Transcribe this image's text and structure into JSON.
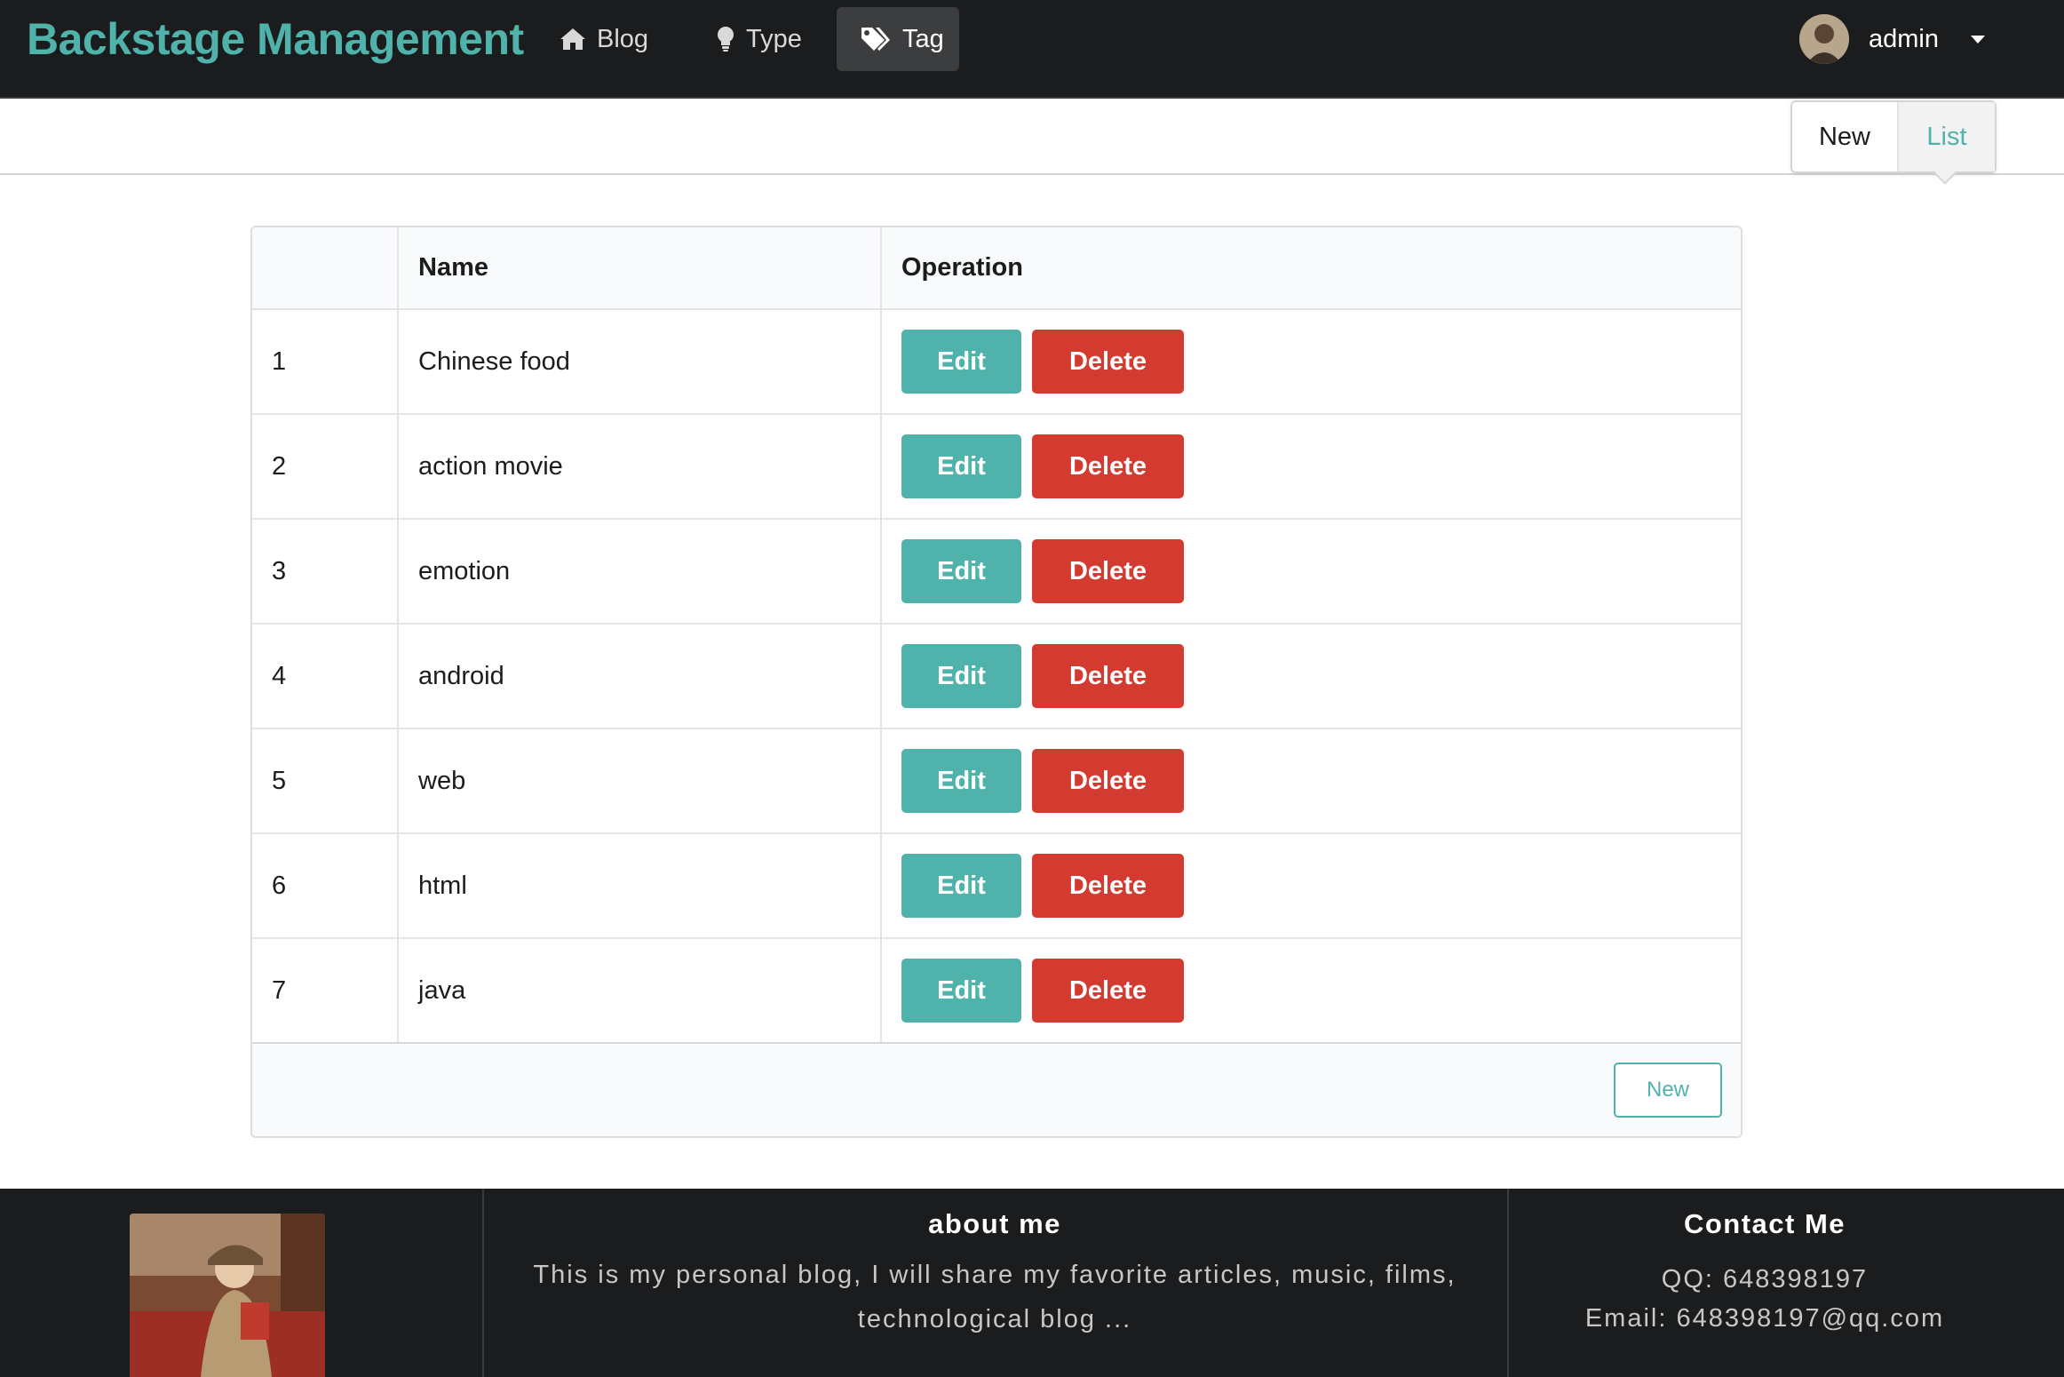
{
  "header": {
    "brand": "Backstage Management",
    "nav": [
      {
        "label": "Blog",
        "icon": "home-icon"
      },
      {
        "label": "Type",
        "icon": "lightbulb-icon"
      },
      {
        "label": "Tag",
        "icon": "tags-icon",
        "active": true
      }
    ],
    "user": {
      "name": "admin"
    }
  },
  "submenu": {
    "tabs": [
      {
        "label": "New"
      },
      {
        "label": "List",
        "active": true
      }
    ]
  },
  "table": {
    "columns": [
      "",
      "Name",
      "Operation"
    ],
    "rows": [
      {
        "id": "1",
        "name": "Chinese food"
      },
      {
        "id": "2",
        "name": "action movie"
      },
      {
        "id": "3",
        "name": "emotion"
      },
      {
        "id": "4",
        "name": "android"
      },
      {
        "id": "5",
        "name": "web"
      },
      {
        "id": "6",
        "name": "html"
      },
      {
        "id": "7",
        "name": "java"
      }
    ],
    "edit_label": "Edit",
    "delete_label": "Delete",
    "new_label": "New"
  },
  "footer": {
    "about_title": "about me",
    "about_text": "This is my personal blog, I will share my favorite articles, music, films, technological blog ...",
    "contact_title": "Contact Me",
    "qq": "QQ:  648398197",
    "email": "Email:  648398197@qq.com"
  },
  "colors": {
    "accent": "#4fb3ab",
    "danger": "#d33b31",
    "dark": "#1b1c1d"
  }
}
